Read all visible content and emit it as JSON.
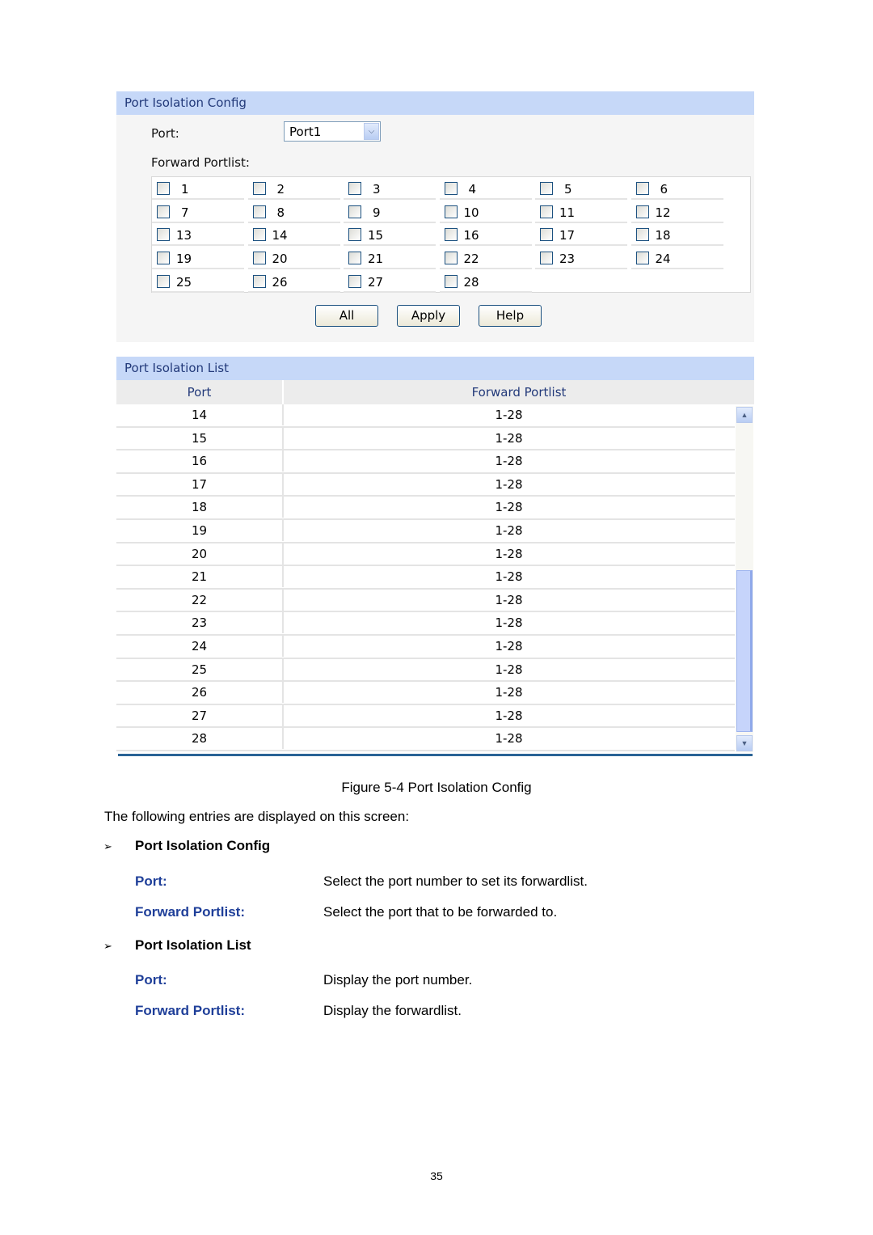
{
  "config_panel": {
    "title": "Port Isolation Config",
    "port_label": "Port:",
    "port_selected": "Port1",
    "forward_portlist_label": "Forward Portlist:",
    "ports": [
      "1",
      "2",
      "3",
      "4",
      "5",
      "6",
      "7",
      "8",
      "9",
      "10",
      "11",
      "12",
      "13",
      "14",
      "15",
      "16",
      "17",
      "18",
      "19",
      "20",
      "21",
      "22",
      "23",
      "24",
      "25",
      "26",
      "27",
      "28"
    ],
    "checked": [],
    "buttons": {
      "all": "All",
      "apply": "Apply",
      "help": "Help"
    }
  },
  "list_panel": {
    "title": "Port Isolation List",
    "columns": [
      "Port",
      "Forward Portlist"
    ],
    "rows": [
      {
        "port": "14",
        "forward": "1-28"
      },
      {
        "port": "15",
        "forward": "1-28"
      },
      {
        "port": "16",
        "forward": "1-28"
      },
      {
        "port": "17",
        "forward": "1-28"
      },
      {
        "port": "18",
        "forward": "1-28"
      },
      {
        "port": "19",
        "forward": "1-28"
      },
      {
        "port": "20",
        "forward": "1-28"
      },
      {
        "port": "21",
        "forward": "1-28"
      },
      {
        "port": "22",
        "forward": "1-28"
      },
      {
        "port": "23",
        "forward": "1-28"
      },
      {
        "port": "24",
        "forward": "1-28"
      },
      {
        "port": "25",
        "forward": "1-28"
      },
      {
        "port": "26",
        "forward": "1-28"
      },
      {
        "port": "27",
        "forward": "1-28"
      },
      {
        "port": "28",
        "forward": "1-28"
      }
    ],
    "scroll_position": "bottom",
    "icons": {
      "scroll_up": "▲",
      "scroll_down": "▼",
      "dropdown": "⌄"
    }
  },
  "document": {
    "figure_caption": "Figure 5-4 Port Isolation Config",
    "intro": "The following entries are displayed on this screen:",
    "bullet_glyph": "➢",
    "sections": [
      {
        "heading": "Port Isolation Config",
        "entries": [
          {
            "term": "Port:",
            "desc": "Select the port number to set its forwardlist."
          },
          {
            "term": "Forward Portlist:",
            "desc": "Select the port that to be forwarded to."
          }
        ]
      },
      {
        "heading": "Port Isolation List",
        "entries": [
          {
            "term": "Port:",
            "desc": "Display the port number."
          },
          {
            "term": "Forward Portlist:",
            "desc": "Display the forwardlist."
          }
        ]
      }
    ],
    "page_number": "35"
  }
}
